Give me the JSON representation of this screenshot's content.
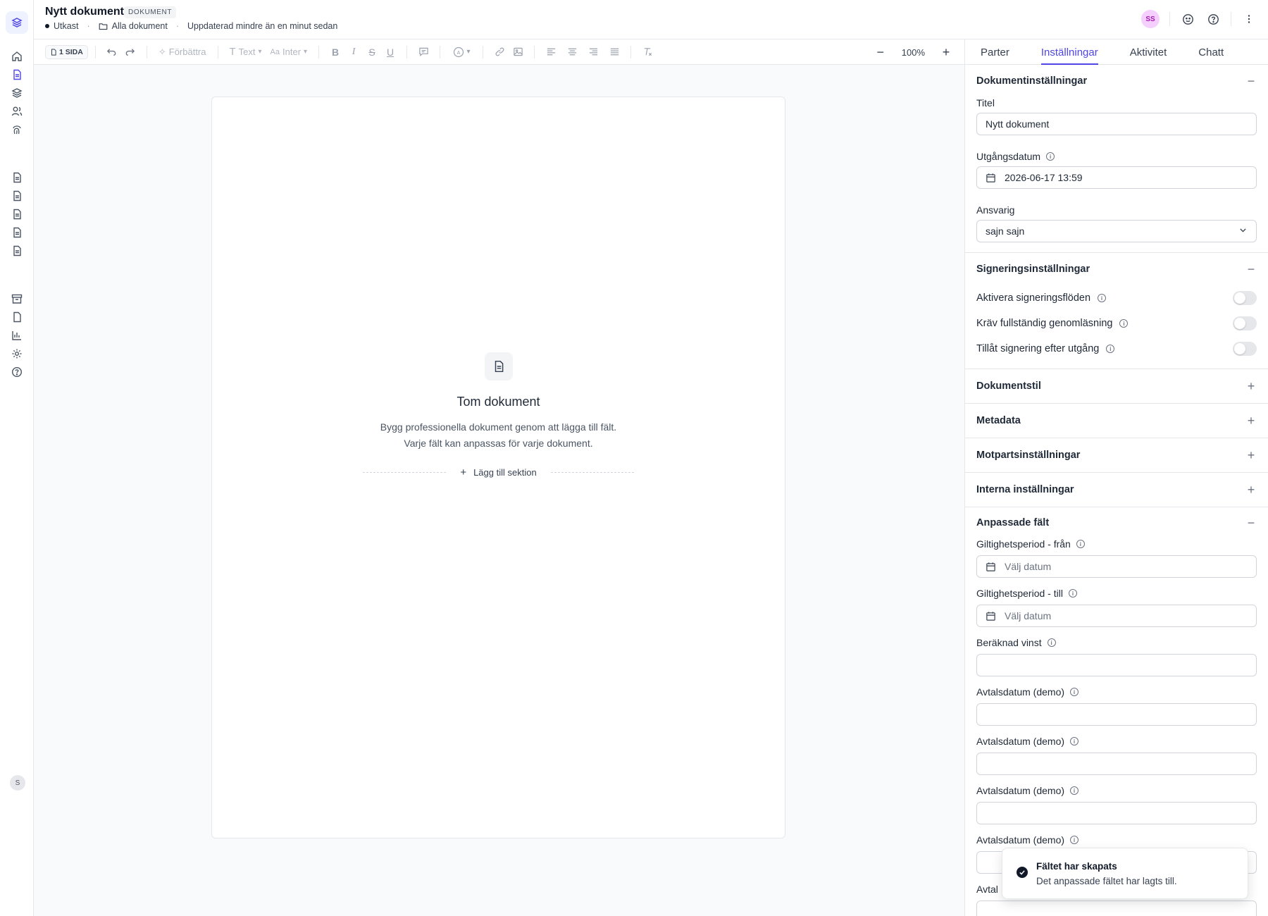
{
  "header": {
    "title": "Nytt dokument",
    "badge": "DOKUMENT",
    "status": "Utkast",
    "folder": "Alla dokument",
    "updated": "Uppdaterad mindre än en minut sedan",
    "avatar_initials": "SS"
  },
  "toolbar": {
    "pages": "1 SIDA",
    "improve": "Förbättra",
    "text_style": "Text",
    "font": "Inter",
    "zoom": "100%"
  },
  "document": {
    "empty_title": "Tom dokument",
    "empty_text": "Bygg professionella dokument genom att lägga till fält. Varje fält kan anpassas för varje dokument.",
    "add_section": "Lägg till sektion"
  },
  "panel": {
    "tabs": [
      "Parter",
      "Inställningar",
      "Aktivitet",
      "Chatt"
    ],
    "active_tab": "Inställningar",
    "doc_settings": {
      "heading": "Dokumentinställningar",
      "title_label": "Titel",
      "title_value": "Nytt dokument",
      "expiry_label": "Utgångsdatum",
      "expiry_value": "2026-06-17 13:59",
      "owner_label": "Ansvarig",
      "owner_value": "sajn sajn"
    },
    "signing": {
      "heading": "Signeringsinställningar",
      "toggles": [
        {
          "label": "Aktivera signeringsflöden",
          "on": false
        },
        {
          "label": "Kräv fullständig genomläsning",
          "on": false
        },
        {
          "label": "Tillåt signering efter utgång",
          "on": false
        }
      ]
    },
    "collapsed_sections": [
      "Dokumentstil",
      "Metadata",
      "Motpartsinställningar",
      "Interna inställningar"
    ],
    "custom": {
      "heading": "Anpassade fält",
      "fields": [
        {
          "label": "Giltighetsperiod - från",
          "placeholder": "Välj datum",
          "type": "date"
        },
        {
          "label": "Giltighetsperiod - till",
          "placeholder": "Välj datum",
          "type": "date"
        },
        {
          "label": "Beräknad vinst",
          "placeholder": "",
          "type": "text"
        },
        {
          "label": "Avtalsdatum (demo)",
          "placeholder": "",
          "type": "text"
        },
        {
          "label": "Avtalsdatum (demo)",
          "placeholder": "",
          "type": "text"
        },
        {
          "label": "Avtalsdatum (demo)",
          "placeholder": "",
          "type": "text"
        },
        {
          "label": "Avtalsdatum (demo)",
          "placeholder": "",
          "type": "text"
        },
        {
          "label": "Avtal",
          "placeholder": "",
          "type": "text"
        }
      ]
    }
  },
  "toast": {
    "title": "Fältet har skapats",
    "message": "Det anpassade fältet har lagts till."
  },
  "rail": {
    "user_initial": "S"
  },
  "colors": {
    "accent": "#4f46e5",
    "avatar_bg": "#f5d0fe"
  }
}
